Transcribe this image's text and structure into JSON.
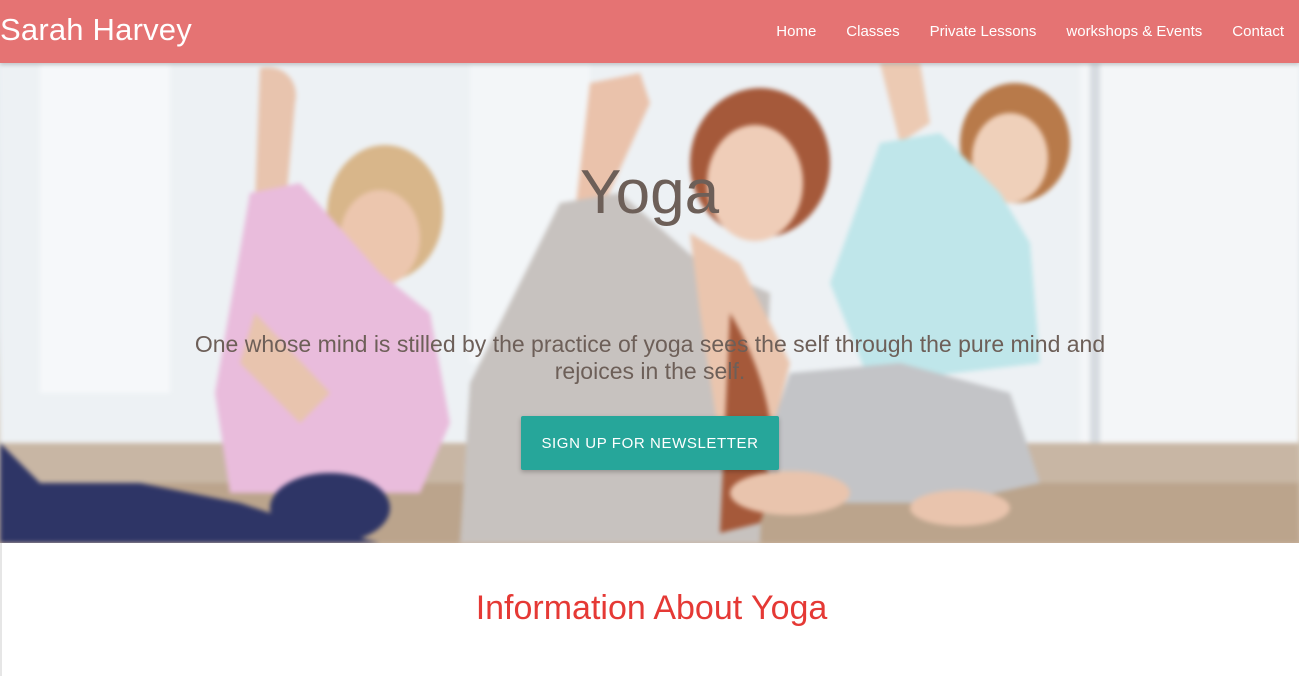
{
  "navbar": {
    "brand": "Sarah Harvey",
    "bg_color": "#e57373",
    "links": [
      {
        "label": "Home"
      },
      {
        "label": "Classes"
      },
      {
        "label": "Private Lessons"
      },
      {
        "label": "workshops & Events"
      },
      {
        "label": "Contact"
      }
    ]
  },
  "hero": {
    "image_desc": "three women doing seated side-stretch yoga poses",
    "title": "Yoga",
    "quote": "One whose mind is stilled by the practice of yoga sees the self through the pure mind and rejoices in the self.",
    "cta_label": "SIGN UP FOR NEWSLETTER",
    "cta_color": "#26a69a",
    "text_color": "#6d5f58"
  },
  "info": {
    "heading": "Information About Yoga",
    "heading_color": "#e53935"
  }
}
